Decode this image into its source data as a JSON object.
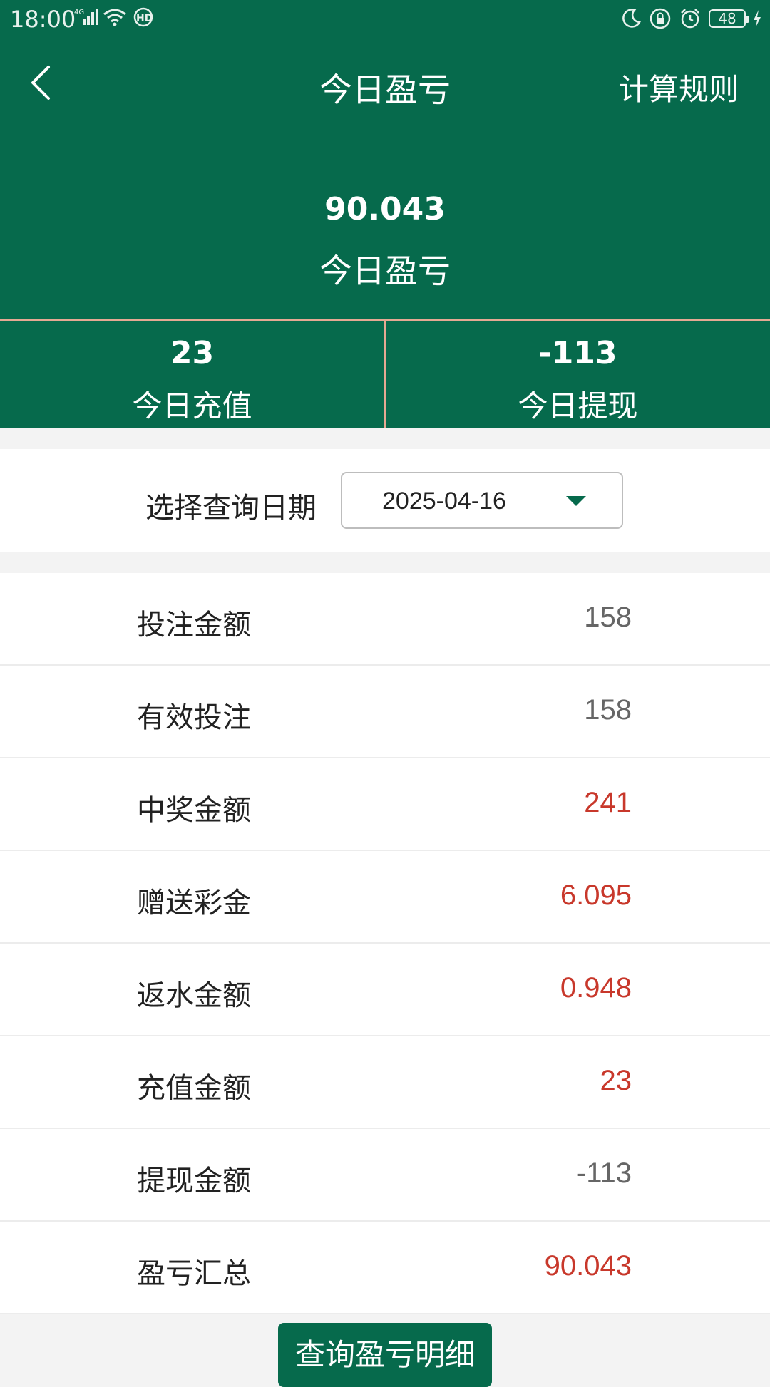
{
  "status_bar": {
    "time": "18:00",
    "network_label": "4G",
    "hd_label": "HD",
    "battery": "48"
  },
  "nav": {
    "title": "今日盈亏",
    "rules_link": "计算规则"
  },
  "hero": {
    "value": "90.043",
    "label": "今日盈亏"
  },
  "stats": [
    {
      "value": "23",
      "label": "今日充值"
    },
    {
      "value": "-113",
      "label": "今日提现"
    }
  ],
  "date_filter": {
    "label": "选择查询日期",
    "value": "2025-04-16"
  },
  "rows": [
    {
      "label": "投注金额",
      "value": "158",
      "color": "#666666"
    },
    {
      "label": "有效投注",
      "value": "158",
      "color": "#666666"
    },
    {
      "label": "中奖金额",
      "value": "241",
      "color": "#c8382b"
    },
    {
      "label": "赠送彩金",
      "value": "6.095",
      "color": "#c8382b"
    },
    {
      "label": "返水金额",
      "value": "0.948",
      "color": "#c8382b"
    },
    {
      "label": "充值金额",
      "value": "23",
      "color": "#c8382b"
    },
    {
      "label": "提现金额",
      "value": "-113",
      "color": "#666666"
    },
    {
      "label": "盈亏汇总",
      "value": "90.043",
      "color": "#c8382b"
    }
  ],
  "query_button": "查询盈亏明细",
  "colors": {
    "primary": "#066a4c",
    "divider_accent": "#e5a993",
    "positive": "#c8382b",
    "neutral": "#666666"
  }
}
